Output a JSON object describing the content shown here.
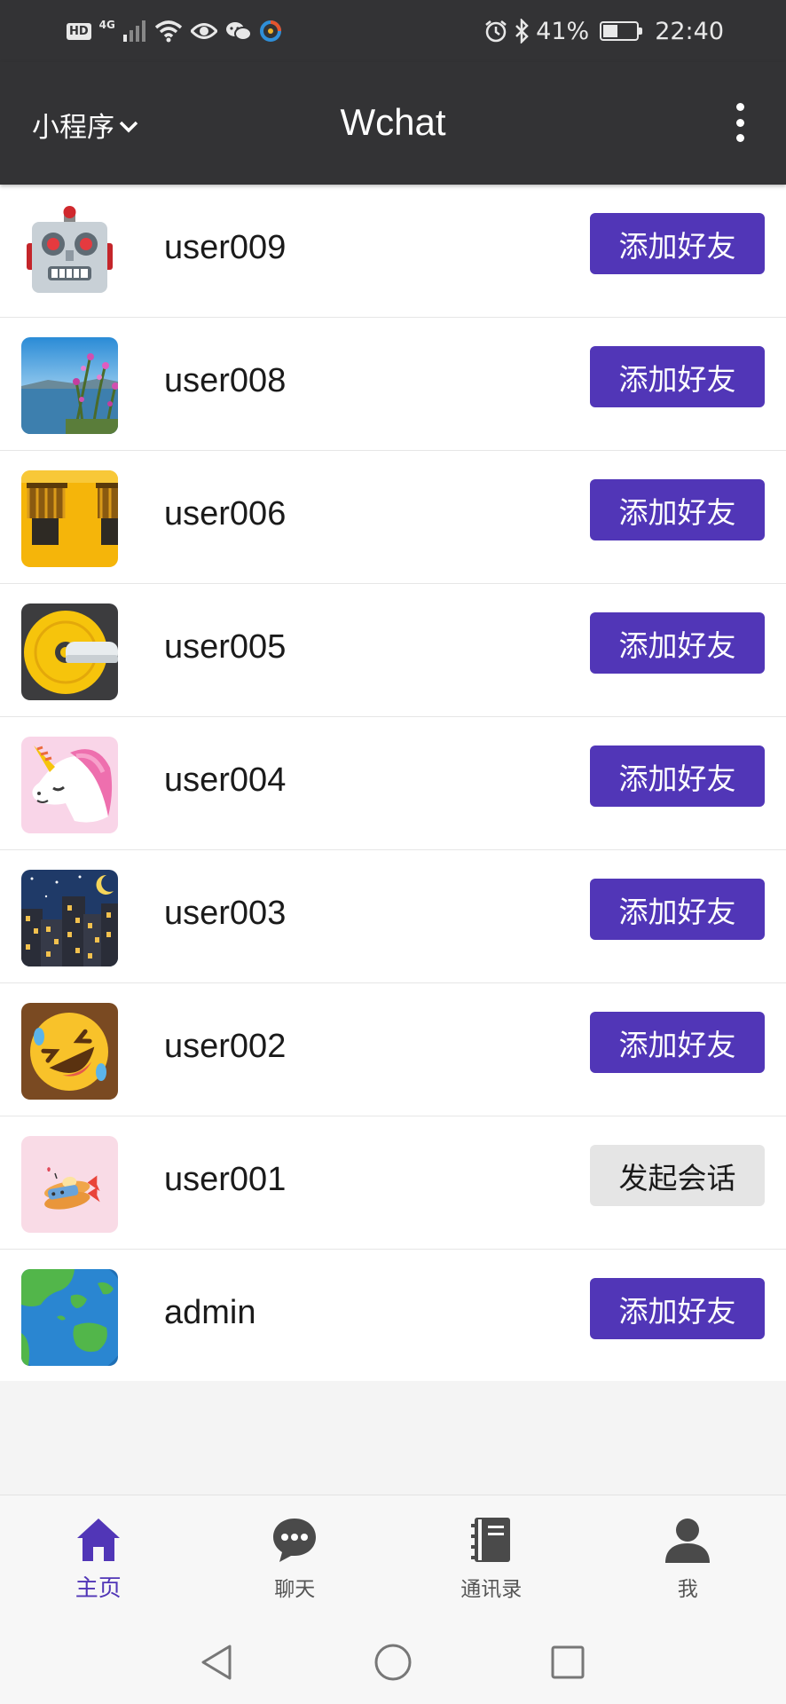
{
  "status_bar": {
    "hd_label": "HD",
    "network_label": "4G",
    "battery_percent": "41%",
    "time": "22:40"
  },
  "header": {
    "left_menu_label": "小程序",
    "title": "Wchat"
  },
  "users": [
    {
      "name": "user009",
      "action": "添加好友",
      "action_type": "add",
      "avatar_icon": "robot-avatar-icon"
    },
    {
      "name": "user008",
      "action": "添加好友",
      "action_type": "add",
      "avatar_icon": "flowers-lake-avatar-icon"
    },
    {
      "name": "user006",
      "action": "添加好友",
      "action_type": "add",
      "avatar_icon": "yellow-building-avatar-icon"
    },
    {
      "name": "user005",
      "action": "添加好友",
      "action_type": "add",
      "avatar_icon": "disc-avatar-icon"
    },
    {
      "name": "user004",
      "action": "添加好友",
      "action_type": "add",
      "avatar_icon": "unicorn-avatar-icon"
    },
    {
      "name": "user003",
      "action": "添加好友",
      "action_type": "add",
      "avatar_icon": "night-city-avatar-icon"
    },
    {
      "name": "user002",
      "action": "添加好友",
      "action_type": "add",
      "avatar_icon": "laughing-face-avatar-icon"
    },
    {
      "name": "user001",
      "action": "发起会话",
      "action_type": "chat",
      "avatar_icon": "fried-shrimp-avatar-icon"
    },
    {
      "name": "admin",
      "action": "添加好友",
      "action_type": "add",
      "avatar_icon": "globe-avatar-icon"
    }
  ],
  "tabs": [
    {
      "label": "主页",
      "icon": "home-icon",
      "active": true
    },
    {
      "label": "聊天",
      "icon": "chat-bubble-icon",
      "active": false
    },
    {
      "label": "通讯录",
      "icon": "address-book-icon",
      "active": false
    },
    {
      "label": "我",
      "icon": "person-icon",
      "active": false
    }
  ],
  "colors": {
    "header_bg": "#333335",
    "accent": "#5136b7",
    "secondary_button": "#e5e5e5"
  }
}
